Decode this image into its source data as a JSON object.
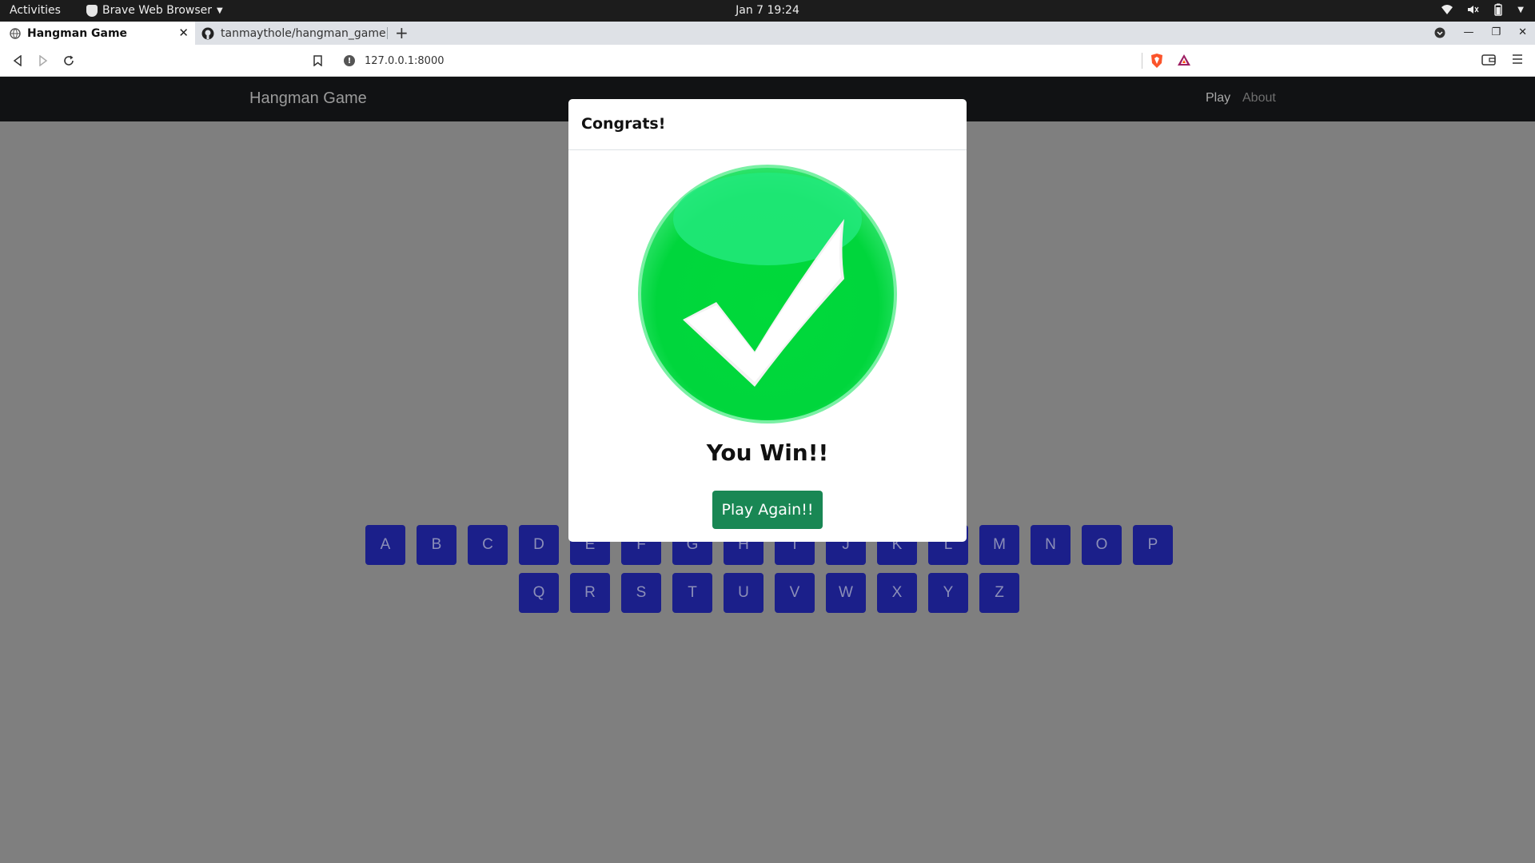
{
  "topbar": {
    "activities": "Activities",
    "app_name": "Brave Web Browser",
    "clock": "Jan 7  19:24"
  },
  "tabs": [
    {
      "title": "Hangman Game",
      "icon": "globe-icon"
    },
    {
      "title": "tanmaythole/hangman_game",
      "icon": "github-icon"
    }
  ],
  "address": {
    "url": "127.0.0.1:8000"
  },
  "site": {
    "brand": "Hangman Game",
    "nav": {
      "play": "Play",
      "about": "About"
    }
  },
  "keyboard": {
    "row1": [
      "A",
      "B",
      "C",
      "D",
      "E",
      "F",
      "G",
      "H",
      "I",
      "J",
      "K",
      "L",
      "M",
      "N",
      "O",
      "P"
    ],
    "row2": [
      "Q",
      "R",
      "S",
      "T",
      "U",
      "V",
      "W",
      "X",
      "Y",
      "Z"
    ]
  },
  "modal": {
    "title": "Congrats!",
    "message": "You Win!!",
    "button": "Play Again!!",
    "icon": "checkmark-circle-icon"
  },
  "colors": {
    "success": "#198754",
    "key_bg": "#1b1f8a",
    "check_green": "#00d639"
  }
}
